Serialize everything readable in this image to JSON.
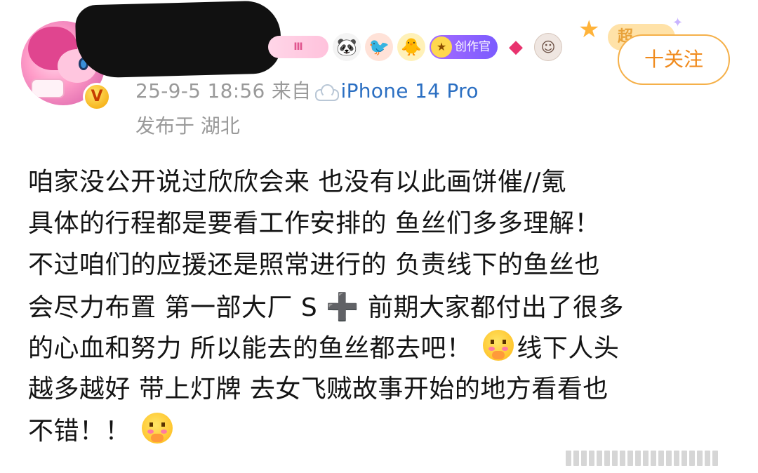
{
  "header": {
    "meta_time": "25-9-5 18:56",
    "meta_from": "来自",
    "meta_device": "iPhone 14 Pro",
    "location": "发布于 湖北",
    "follow_label": "十关注",
    "verified_mark": "V"
  },
  "badges": {
    "level_label": "Ⅲ",
    "creator_label": "创作官",
    "super_label": "超"
  },
  "post": {
    "lines": [
      "咱家没公开说过欣欣会来 也没有以此画饼催//氪",
      "具体的行程都是要看工作安排的 鱼丝们多多理解！",
      "不过咱们的应援还是照常进行的 负责线下的鱼丝也",
      "会尽力布置 第一部大厂 S",
      "前期大家都付出了很多",
      "的心血和努力 所以能去的鱼丝都去吧！",
      "线下人头",
      "越多越好 带上灯牌 去女飞贼故事开始的地方看看也",
      "不错！！"
    ],
    "plus_glyph": "➕"
  },
  "colors": {
    "accent_orange": "#f08a1c",
    "follow_border": "#f5b049",
    "meta_gray": "#9a9a9a",
    "device_blue": "#2b6fc2"
  },
  "icons": [
    "verified-v-icon",
    "panda-icon",
    "bird-icon",
    "chick-icon",
    "gem-icon",
    "cloud-icon",
    "blush-emoji-icon",
    "star-icon"
  ]
}
